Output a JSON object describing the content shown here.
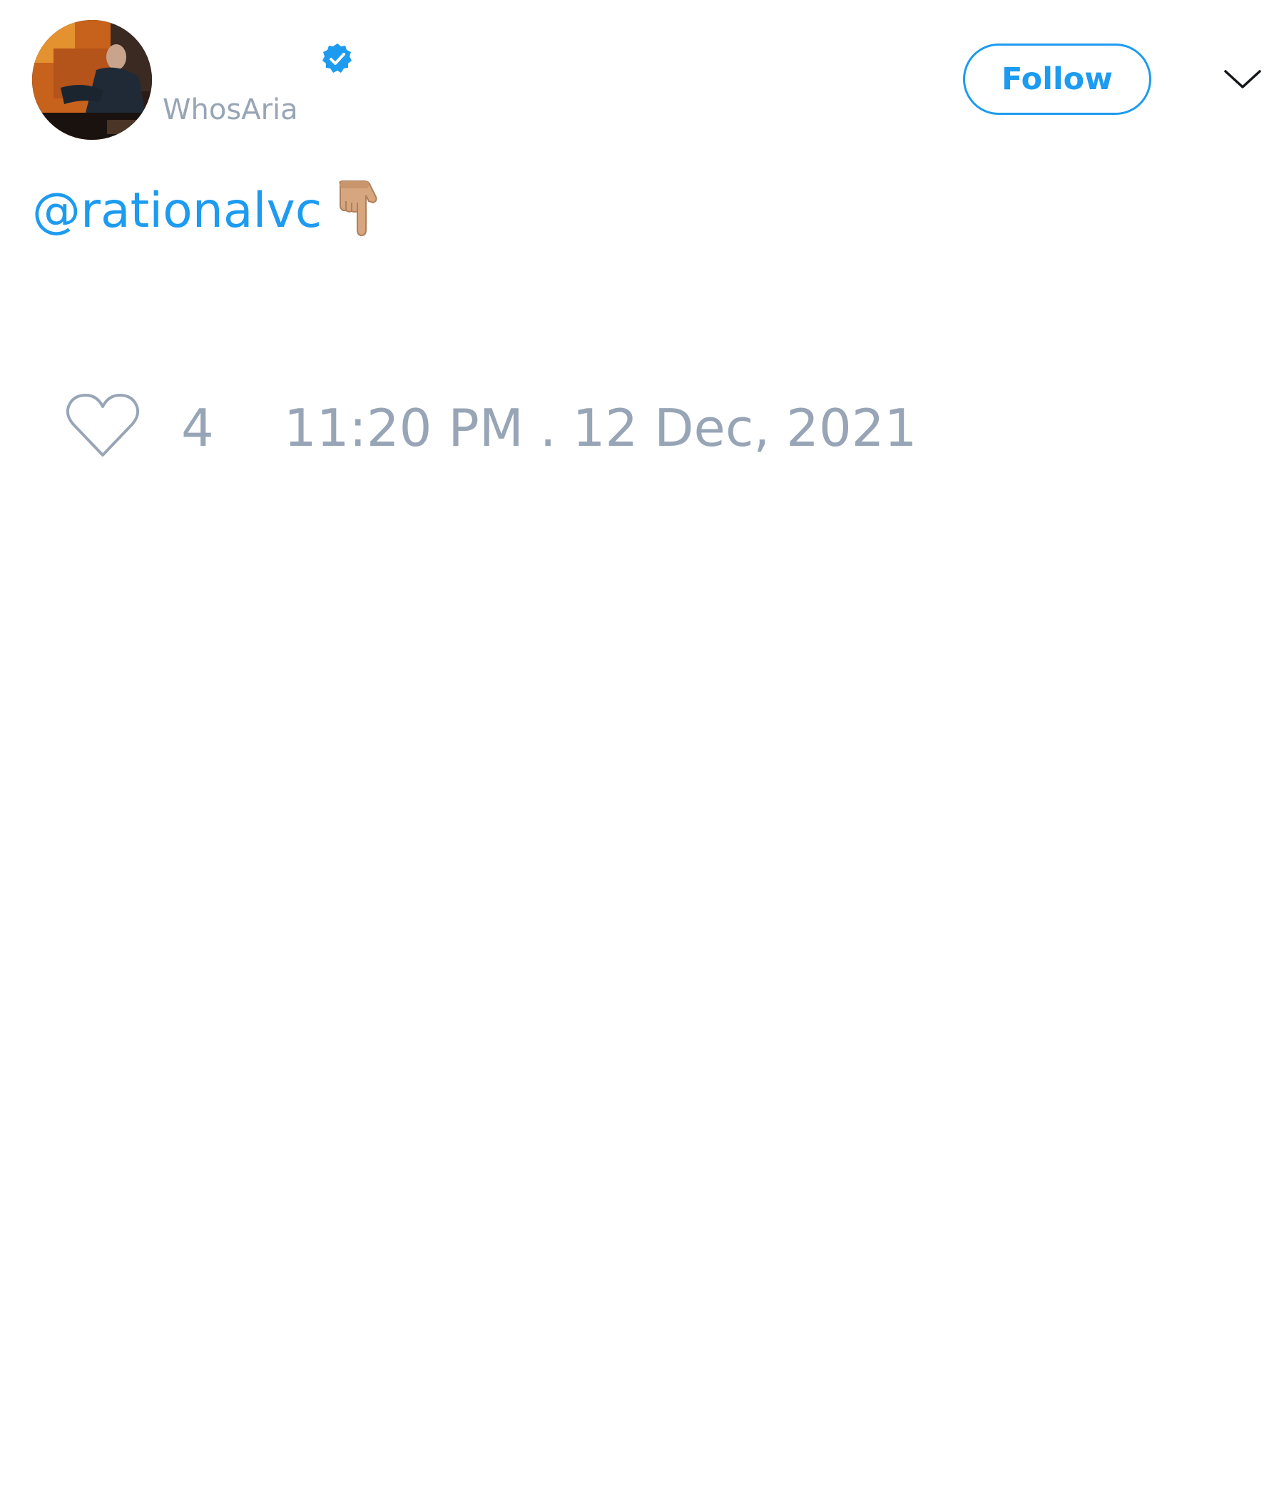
{
  "author": {
    "display_name": "",
    "handle": "WhosAria",
    "verified": true,
    "avatar_icon": "profile-photo"
  },
  "actions": {
    "follow_label": "Follow",
    "menu_icon": "chevron-down-icon"
  },
  "tweet": {
    "mention": "@rationalvc",
    "emoji": "backhand-index-pointing-down-medium-light-skin-tone"
  },
  "footer": {
    "like_icon": "heart-icon",
    "like_count": "4",
    "timestamp": "11:20 PM . 12 Dec, 2021"
  },
  "colors": {
    "accent": "#1d9bf0",
    "muted_text": "#97a5b6",
    "background": "#ffffff"
  }
}
